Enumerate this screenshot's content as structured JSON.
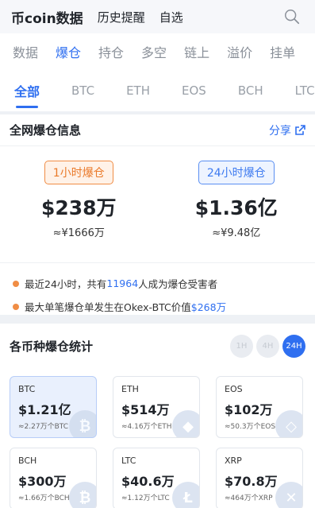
{
  "topbar": {
    "brand": "币coin数据",
    "nav": [
      "历史提醒",
      "自选"
    ],
    "search_icon": "search-icon"
  },
  "subtabs": [
    "数据",
    "爆仓",
    "持仓",
    "多空",
    "链上",
    "溢价",
    "挂单"
  ],
  "coins": [
    "全部",
    "BTC",
    "ETH",
    "EOS",
    "BCH",
    "LTC"
  ],
  "summary": {
    "title": "全网爆仓信息",
    "share": "分享",
    "kpis": [
      {
        "badge": "1小时爆仓",
        "value": "$238万",
        "sub": "≈¥1666万",
        "accent": "#ea7a2a"
      },
      {
        "badge": "24小时爆仓",
        "value": "$1.36亿",
        "sub": "≈¥9.48亿",
        "accent": "#3d7af0"
      }
    ],
    "bullet1": {
      "pre": "最近24小时，共有",
      "num": "11964",
      "post": "人成为爆仓受害者"
    },
    "bullet2": {
      "pre": "最大单笔爆仓单发生在Okex-BTC价值",
      "num": "$268万"
    }
  },
  "stats": {
    "title": "各币种爆仓统计",
    "periods": [
      "1H",
      "4H",
      "24H"
    ],
    "active_period": "24H",
    "cards": [
      {
        "sym": "BTC",
        "amt": "$1.21亿",
        "sub": "≈2.27万个BTC",
        "icon": "bitcoin-icon",
        "glyph": "₿"
      },
      {
        "sym": "ETH",
        "amt": "$514万",
        "sub": "≈4.16万个ETH",
        "icon": "ethereum-icon",
        "glyph": "◆"
      },
      {
        "sym": "EOS",
        "amt": "$102万",
        "sub": "≈50.3万个EOS",
        "icon": "eos-icon",
        "glyph": "◇"
      },
      {
        "sym": "BCH",
        "amt": "$300万",
        "sub": "≈1.66万个BCH",
        "icon": "bitcoin-cash-icon",
        "glyph": "₿"
      },
      {
        "sym": "LTC",
        "amt": "$40.6万",
        "sub": "≈1.12万个LTC",
        "icon": "litecoin-icon",
        "glyph": "Ł"
      },
      {
        "sym": "XRP",
        "amt": "$70.8万",
        "sub": "≈464万个XRP",
        "icon": "ripple-icon",
        "glyph": "✕"
      }
    ]
  },
  "colors": {
    "accent": "#2f6ff0",
    "orange": "#f08d45"
  }
}
